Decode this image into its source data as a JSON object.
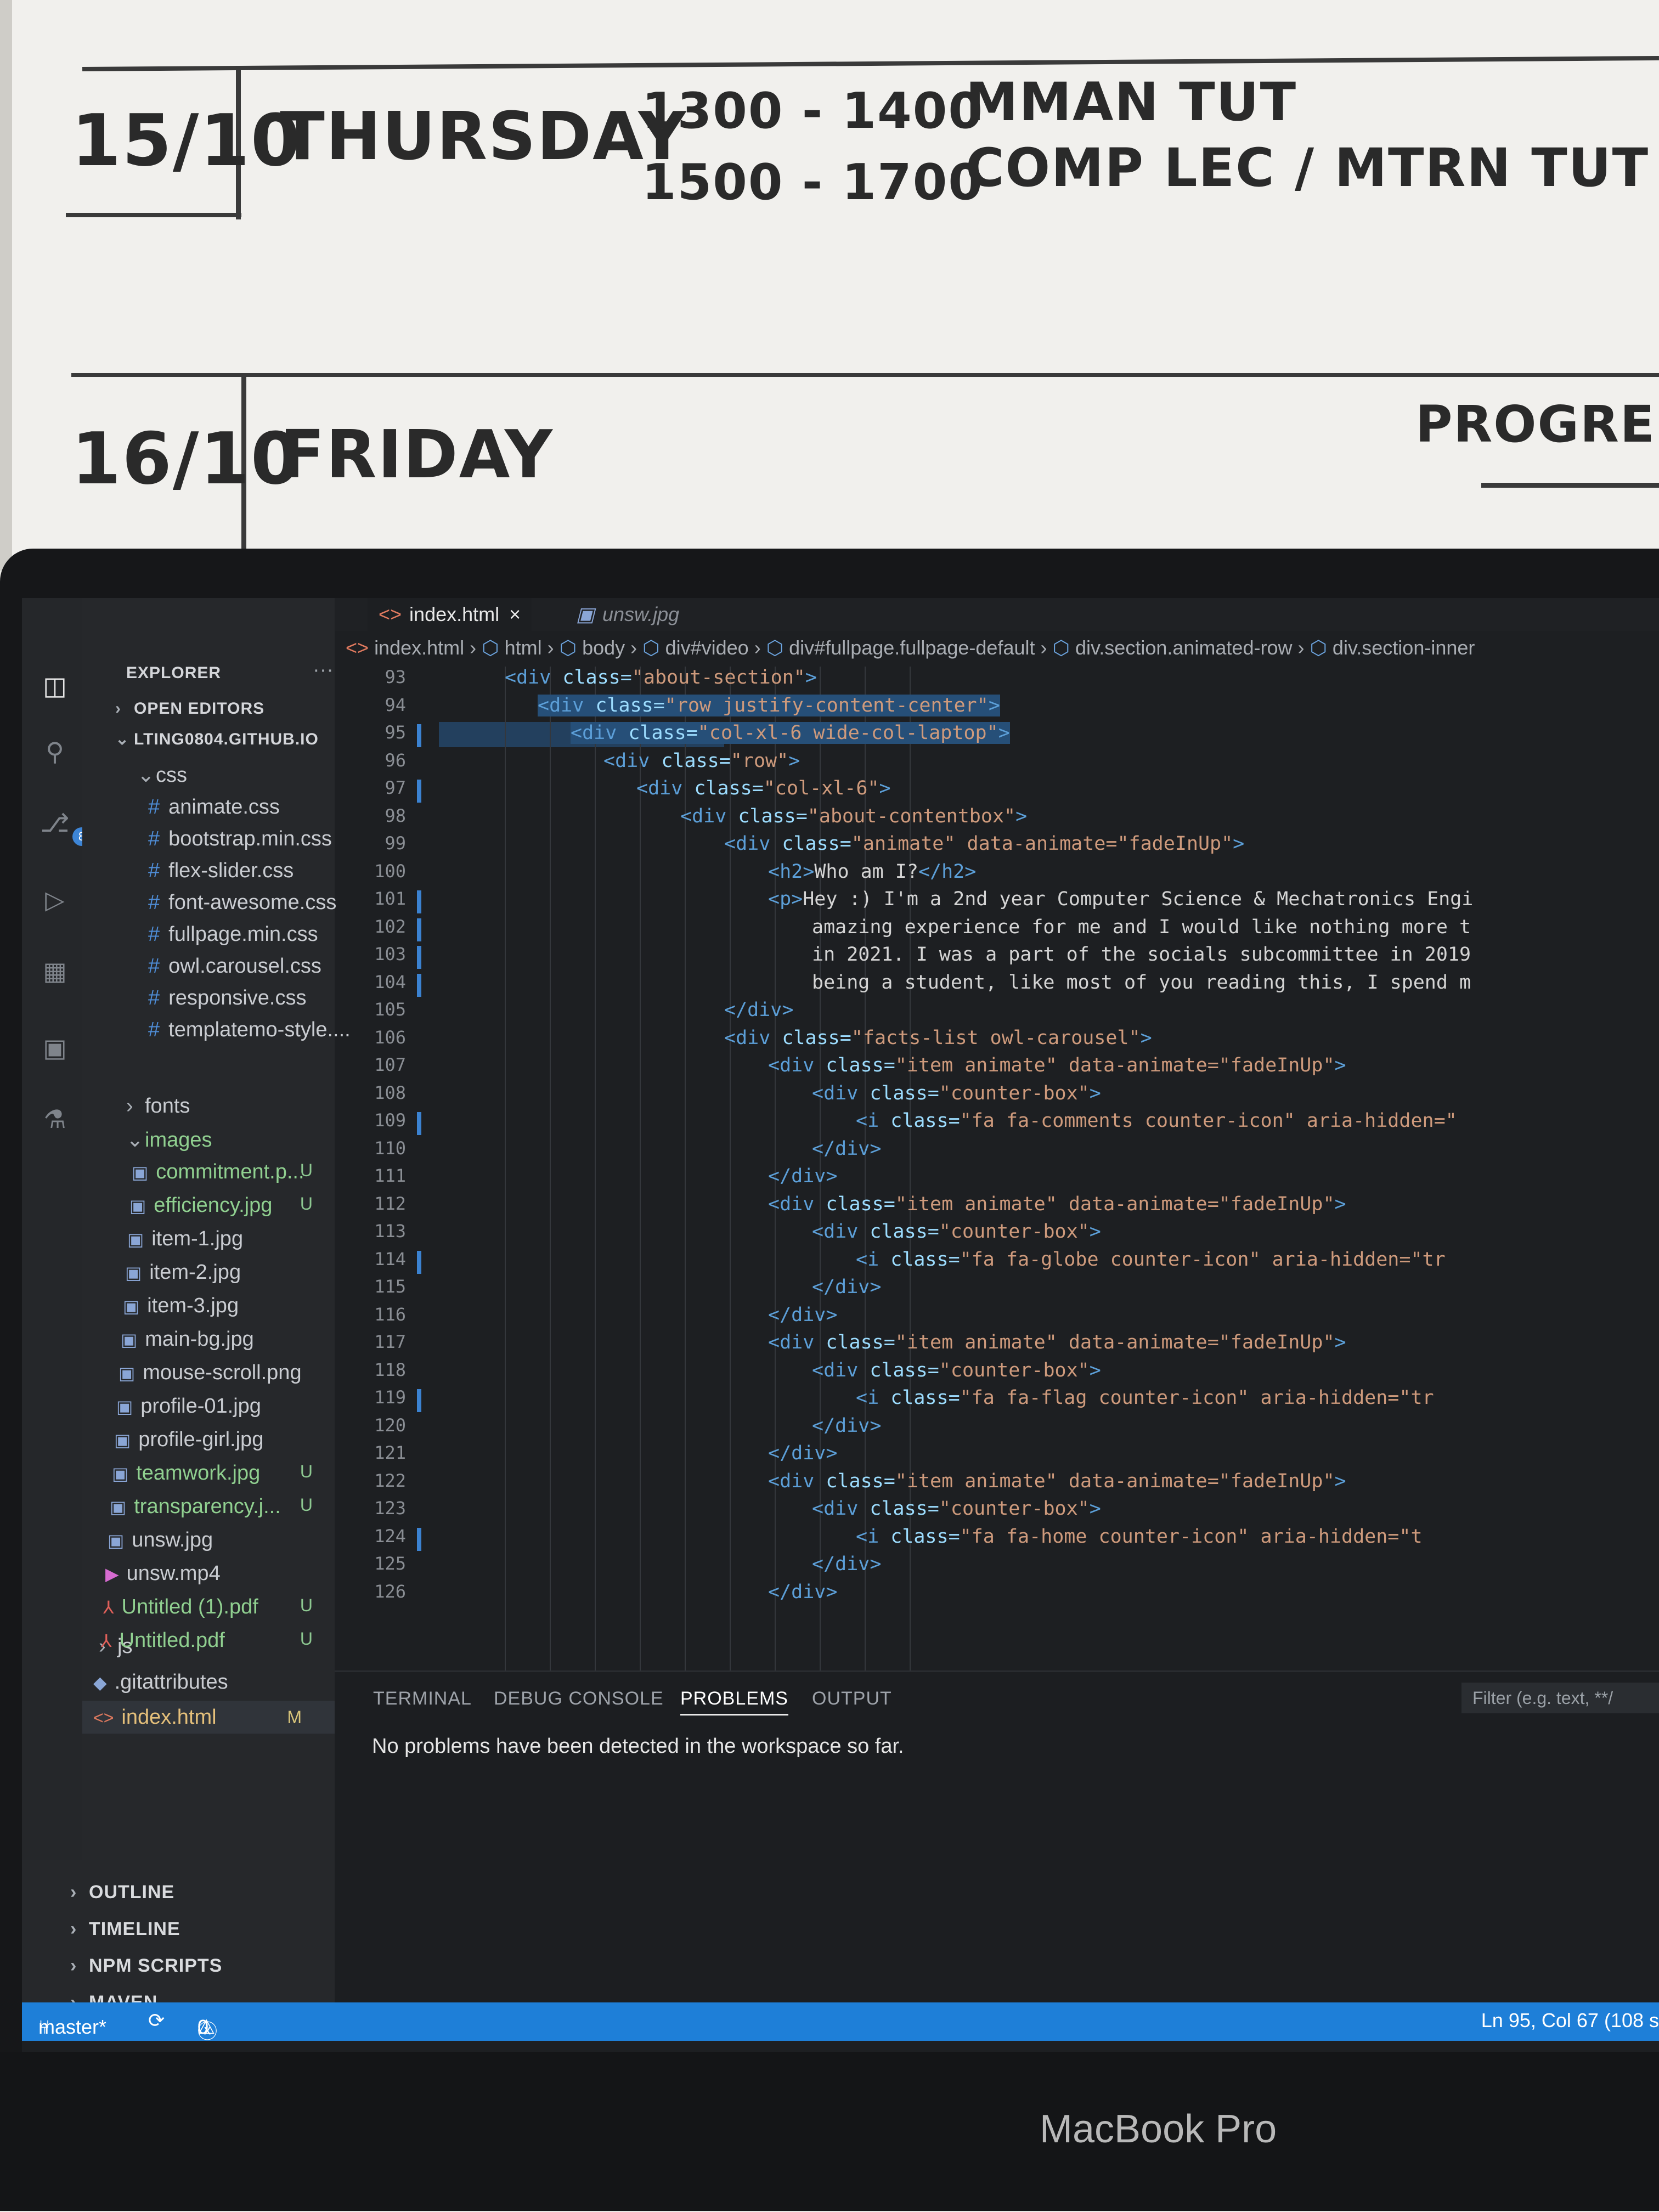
{
  "whiteboard": {
    "row1": {
      "date": "15/10",
      "day": "THURSDAY",
      "time1": "1300 - 1400",
      "event1": "MMAN TUT",
      "time2": "1500 - 1700",
      "event2": "COMP LEC / MTRN TUT"
    },
    "row2": {
      "date": "16/10",
      "day": "FRIDAY",
      "note": "PROGRESS"
    }
  },
  "laptop": {
    "brand": "MacBook Pro"
  },
  "activity_bar": {
    "scm_badge": "8"
  },
  "explorer": {
    "title": "EXPLORER",
    "more": "···",
    "open_editors": "OPEN EDITORS",
    "root": "LTING0804.GITHUB.IO",
    "css_folder": "css",
    "css_files": [
      "animate.css",
      "bootstrap.min.css",
      "flex-slider.css",
      "font-awesome.css",
      "fullpage.min.css",
      "owl.carousel.css",
      "responsive.css",
      "templatemo-style...."
    ],
    "fonts_folder": "fonts",
    "images_folder": "images",
    "image_files": [
      {
        "name": "commitment.p...",
        "status": "U"
      },
      {
        "name": "efficiency.jpg",
        "status": "U"
      },
      {
        "name": "item-1.jpg",
        "status": ""
      },
      {
        "name": "item-2.jpg",
        "status": ""
      },
      {
        "name": "item-3.jpg",
        "status": ""
      },
      {
        "name": "main-bg.jpg",
        "status": ""
      },
      {
        "name": "mouse-scroll.png",
        "status": ""
      },
      {
        "name": "profile-01.jpg",
        "status": ""
      },
      {
        "name": "profile-girl.jpg",
        "status": ""
      },
      {
        "name": "teamwork.jpg",
        "status": "U"
      },
      {
        "name": "transparency.j...",
        "status": "U"
      },
      {
        "name": "unsw.jpg",
        "status": ""
      },
      {
        "name": "unsw.mp4",
        "status": ""
      },
      {
        "name": "Untitled (1).pdf",
        "status": "U"
      },
      {
        "name": "Untitled.pdf",
        "status": "U"
      }
    ],
    "js_folder": "js",
    "gitattributes": ".gitattributes",
    "index_file": "index.html",
    "index_status": "M",
    "sections": [
      "OUTLINE",
      "TIMELINE",
      "NPM SCRIPTS",
      "MAVEN"
    ]
  },
  "tabs": [
    {
      "label": "index.html",
      "close": "×"
    },
    {
      "label": "unsw.jpg"
    }
  ],
  "breadcrumbs": [
    "index.html",
    "html",
    "body",
    "div#video",
    "div#fullpage.fullpage-default",
    "div.section.animated-row",
    "div.section-inner"
  ],
  "line_numbers": [
    "93",
    "94",
    "95",
    "96",
    "97",
    "98",
    "99",
    "100",
    "101",
    "102",
    "103",
    "104",
    "105",
    "106",
    "107",
    "108",
    "109",
    "110",
    "111",
    "112",
    "113",
    "114",
    "115",
    "116",
    "117",
    "118",
    "119",
    "120",
    "121",
    "122",
    "123",
    "124",
    "125",
    "126"
  ],
  "code_lines": [
    {
      "tag": "<div ",
      "attr": "class=",
      "str": "\"about-section\"",
      "end": ">"
    },
    {
      "tag": "<div ",
      "attr": "class=",
      "str": "\"row justify-content-center\"",
      "end": ">"
    },
    {
      "tag": "<div ",
      "attr": "class=",
      "str": "\"col-xl-6 wide-col-laptop\"",
      "end": ">"
    },
    {
      "tag": "<div ",
      "attr": "class=",
      "str": "\"row\"",
      "end": ">"
    },
    {
      "tag": "<div ",
      "attr": "class=",
      "str": "\"col-xl-6\"",
      "end": ">"
    },
    {
      "tag": "<div ",
      "attr": "class=",
      "str": "\"about-contentbox\"",
      "end": ">"
    },
    {
      "tag": "<div ",
      "attr": "class=",
      "str": "\"animate\" data-animate=\"fadeInUp\"",
      "end": ">"
    },
    {
      "tag": "<h2>",
      "attr": "",
      "str": "Who am I?",
      "end": "</h2>"
    },
    {
      "tag": "<p>",
      "attr": "",
      "str": "Hey :) I'm a 2nd year Computer Science & Mechatronics Engi",
      "end": ""
    },
    {
      "tag": "",
      "attr": "",
      "str": "amazing experience for me and I would like nothing more t",
      "end": ""
    },
    {
      "tag": "",
      "attr": "",
      "str": "in 2021. I was a part of the socials subcommittee in 2019",
      "end": ""
    },
    {
      "tag": "",
      "attr": "",
      "str": "being a student, like most of you reading this, I spend m",
      "end": ""
    },
    {
      "tag": "</div>",
      "attr": "",
      "str": "",
      "end": ""
    },
    {
      "tag": "<div ",
      "attr": "class=",
      "str": "\"facts-list owl-carousel\"",
      "end": ">"
    },
    {
      "tag": "<div ",
      "attr": "class=",
      "str": "\"item animate\" data-animate=\"fadeInUp\"",
      "end": ">"
    },
    {
      "tag": "<div ",
      "attr": "class=",
      "str": "\"counter-box\"",
      "end": ">"
    },
    {
      "tag": "<i ",
      "attr": "class=",
      "str": "\"fa fa-comments counter-icon\" aria-hidden=\"",
      "end": ""
    },
    {
      "tag": "</div>",
      "attr": "",
      "str": "",
      "end": ""
    },
    {
      "tag": "</div>",
      "attr": "",
      "str": "",
      "end": ""
    },
    {
      "tag": "<div ",
      "attr": "class=",
      "str": "\"item animate\" data-animate=\"fadeInUp\"",
      "end": ">"
    },
    {
      "tag": "<div ",
      "attr": "class=",
      "str": "\"counter-box\"",
      "end": ">"
    },
    {
      "tag": "<i ",
      "attr": "class=",
      "str": "\"fa fa-globe counter-icon\" aria-hidden=\"tr",
      "end": ""
    },
    {
      "tag": "</div>",
      "attr": "",
      "str": "",
      "end": ""
    },
    {
      "tag": "</div>",
      "attr": "",
      "str": "",
      "end": ""
    },
    {
      "tag": "<div ",
      "attr": "class=",
      "str": "\"item animate\" data-animate=\"fadeInUp\"",
      "end": ">"
    },
    {
      "tag": "<div ",
      "attr": "class=",
      "str": "\"counter-box\"",
      "end": ">"
    },
    {
      "tag": "<i ",
      "attr": "class=",
      "str": "\"fa fa-flag counter-icon\" aria-hidden=\"tr",
      "end": ""
    },
    {
      "tag": "</div>",
      "attr": "",
      "str": "",
      "end": ""
    },
    {
      "tag": "</div>",
      "attr": "",
      "str": "",
      "end": ""
    },
    {
      "tag": "<div ",
      "attr": "class=",
      "str": "\"item animate\" data-animate=\"fadeInUp\"",
      "end": ">"
    },
    {
      "tag": "<div ",
      "attr": "class=",
      "str": "\"counter-box\"",
      "end": ">"
    },
    {
      "tag": "<i ",
      "attr": "class=",
      "str": "\"fa fa-home counter-icon\" aria-hidden=\"t",
      "end": ""
    },
    {
      "tag": "</div>",
      "attr": "",
      "str": "",
      "end": ""
    },
    {
      "tag": "</div>",
      "attr": "",
      "str": "",
      "end": ""
    }
  ],
  "panel": {
    "tabs": [
      "TERMINAL",
      "DEBUG CONSOLE",
      "PROBLEMS",
      "OUTPUT"
    ],
    "active_tab": "PROBLEMS",
    "message": "No problems have been detected in the workspace so far.",
    "filter_placeholder": "Filter (e.g. text, **/"
  },
  "status_bar": {
    "branch": "master*",
    "errors": "0",
    "warnings": "0",
    "position": "Ln 95, Col 67 (108 s"
  }
}
